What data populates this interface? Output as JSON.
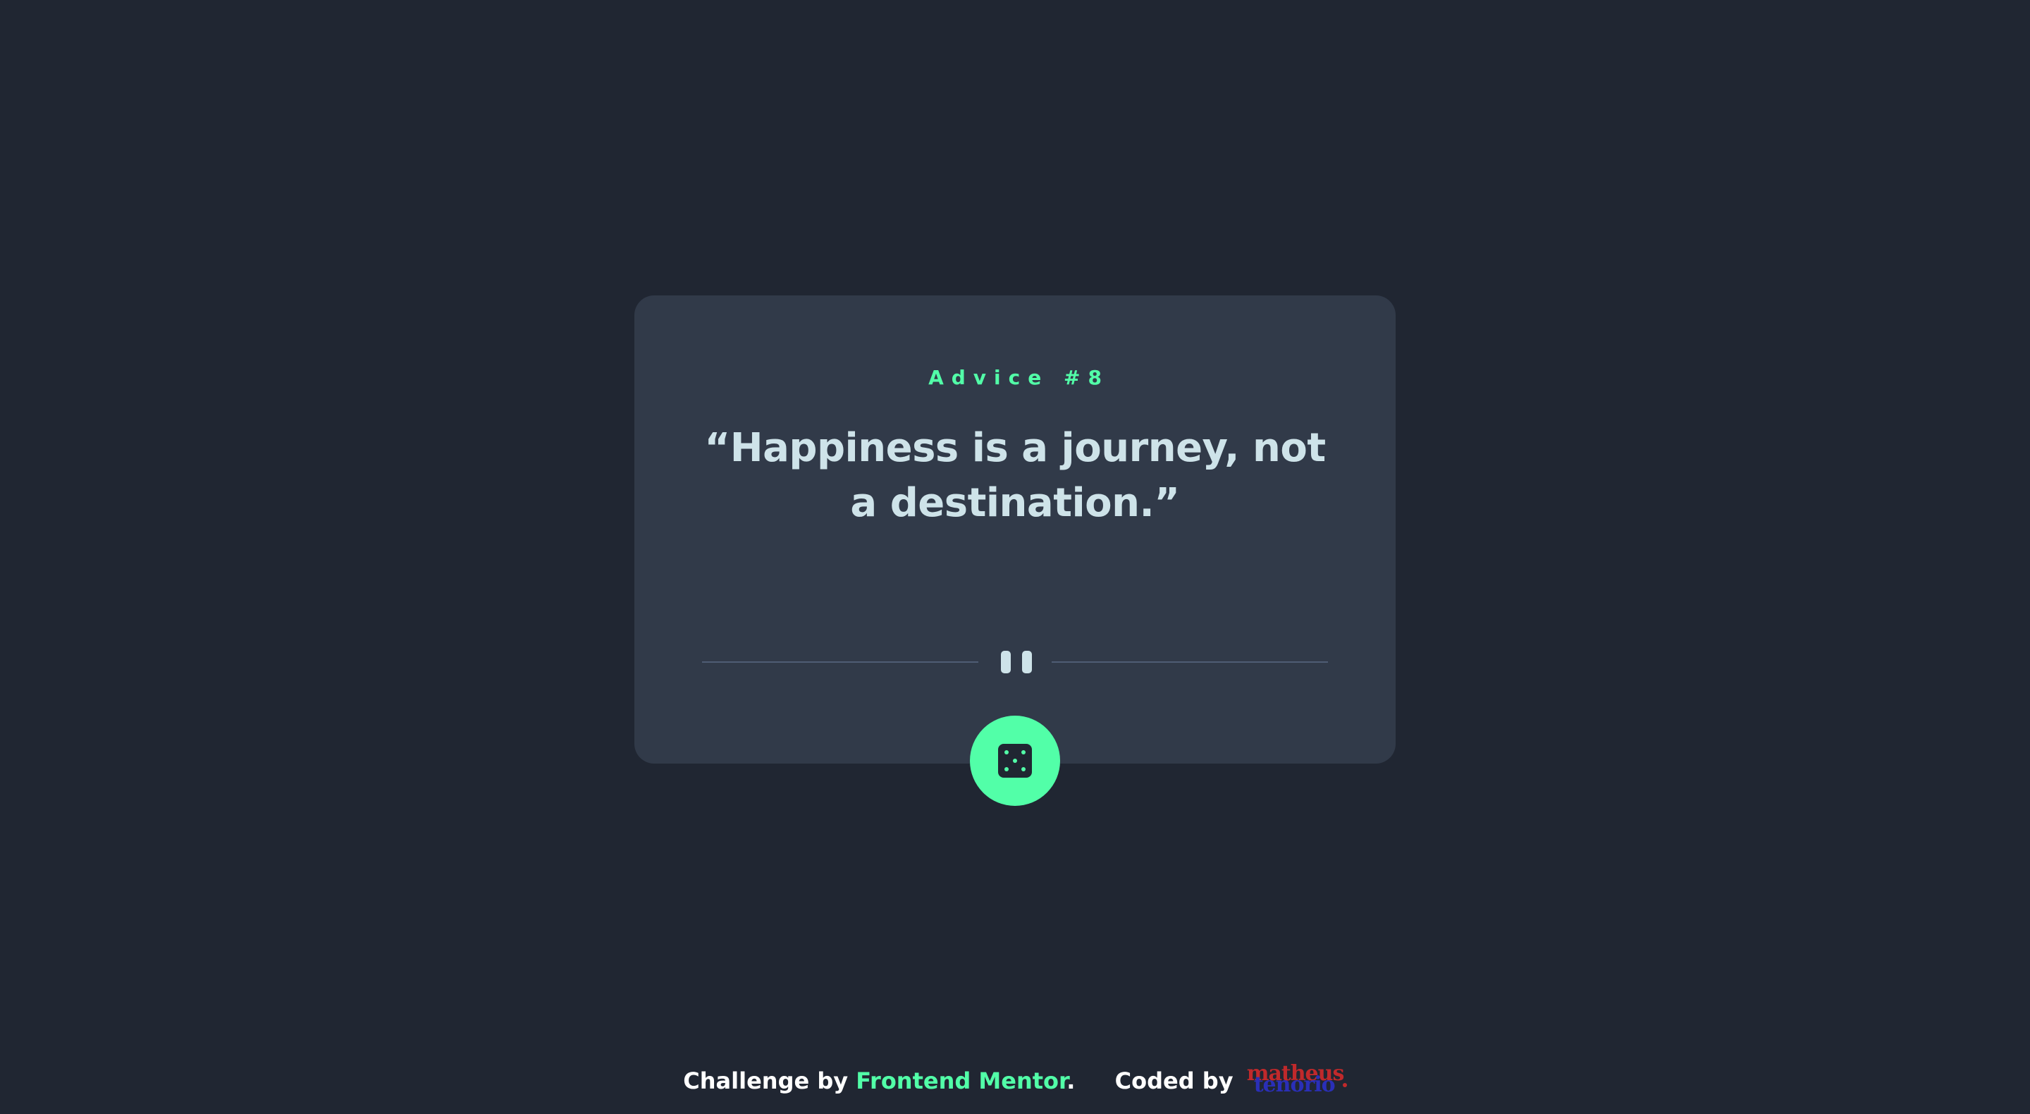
{
  "card": {
    "advice_label": "Advice #8",
    "quote": "“Happiness is a journey, not a destination.”"
  },
  "icons": {
    "divider": "pause-icon",
    "dice": "dice-icon"
  },
  "footer": {
    "challenge_prefix": "Challenge by",
    "challenge_link": "Frontend Mentor",
    "challenge_suffix": ".",
    "coded_prefix": "Coded by",
    "author_logo_line1": "matheus",
    "author_logo_line2": "tenorio"
  },
  "colors": {
    "background": "#202632",
    "card": "#313a49",
    "accent": "#52ffa8",
    "text": "#cee3e9",
    "divider": "#4f5d74",
    "logo_red": "#c0292b",
    "logo_blue": "#2a2fb8"
  }
}
